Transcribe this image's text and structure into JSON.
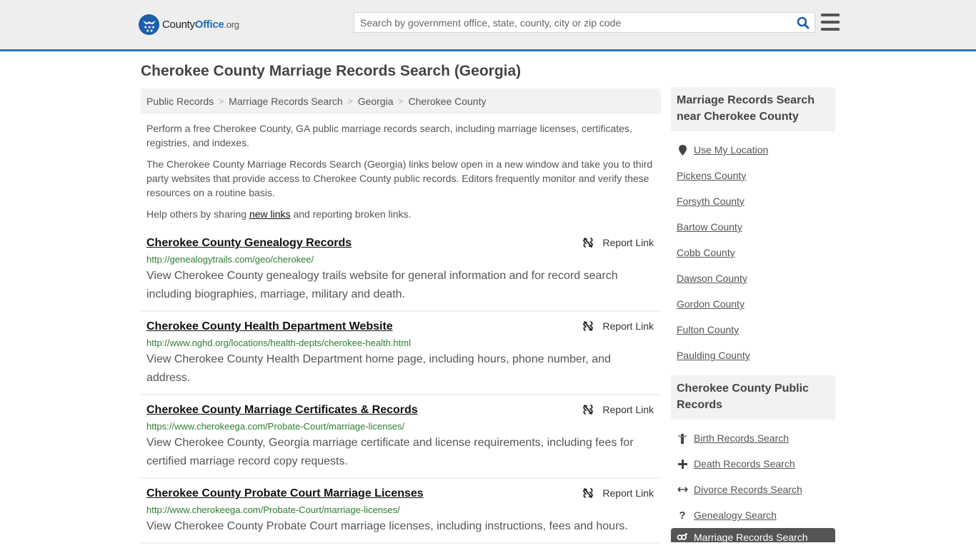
{
  "header": {
    "logo": {
      "brand_prefix": "County",
      "brand_main": "Office",
      "brand_suffix": ".org"
    },
    "search": {
      "placeholder": "Search by government office, state, county, city or zip code",
      "value": ""
    },
    "icons": {
      "search": "search-icon",
      "menu": "hamburger-menu-icon"
    }
  },
  "page": {
    "title": "Cherokee County Marriage Records Search (Georgia)"
  },
  "breadcrumb": [
    {
      "label": "Public Records"
    },
    {
      "label": "Marriage Records Search"
    },
    {
      "label": "Georgia"
    },
    {
      "label": "Cherokee County"
    }
  ],
  "breadcrumb_separator": ">",
  "intro": {
    "p1": "Perform a free Cherokee County, GA public marriage records search, including marriage licenses, certificates, registries, and indexes.",
    "p2": "The Cherokee County Marriage Records Search (Georgia) links below open in a new window and take you to third party websites that provide access to Cherokee County public records. Editors frequently monitor and verify these resources on a routine basis.",
    "p3_before": "Help others by sharing ",
    "p3_link": "new links",
    "p3_after": " and reporting broken links."
  },
  "results": [
    {
      "title": "Cherokee County Genealogy Records",
      "url": "http://genealogytrails.com/geo/cherokee/",
      "description": "View Cherokee County genealogy trails website for general information and for record search including biographies, marriage, military and death.",
      "report_label": "Report Link"
    },
    {
      "title": "Cherokee County Health Department Website",
      "url": "http://www.nghd.org/locations/health-depts/cherokee-health.html",
      "description": "View Cherokee County Health Department home page, including hours, phone number, and address.",
      "report_label": "Report Link"
    },
    {
      "title": "Cherokee County Marriage Certificates & Records",
      "url": "https://www.cherokeega.com/Probate-Court/marriage-licenses/",
      "description": "View Cherokee County, Georgia marriage certificate and license requirements, including fees for certified marriage record copy requests.",
      "report_label": "Report Link"
    },
    {
      "title": "Cherokee County Probate Court Marriage Licenses",
      "url": "http://www.cherokeega.com/Probate-Court/marriage-licenses/",
      "description": "View Cherokee County Probate Court marriage licenses, including instructions, fees and hours.",
      "report_label": "Report Link"
    }
  ],
  "sidebar": {
    "nearby": {
      "heading": "Marriage Records Search near Cherokee County",
      "use_location": "Use My Location",
      "counties": [
        "Pickens County",
        "Forsyth County",
        "Bartow County",
        "Cobb County",
        "Dawson County",
        "Gordon County",
        "Fulton County",
        "Paulding County"
      ]
    },
    "public_records": {
      "heading": "Cherokee County Public Records",
      "items": [
        {
          "label": "Birth Records Search",
          "icon": "child-icon"
        },
        {
          "label": "Death Records Search",
          "icon": "plus-icon"
        },
        {
          "label": "Divorce Records Search",
          "icon": "arrows-horizontal-icon"
        },
        {
          "label": "Genealogy Search",
          "icon": "question-icon"
        }
      ],
      "active_item": {
        "label": "Marriage Records Search",
        "icon": "gender-icon"
      }
    }
  }
}
